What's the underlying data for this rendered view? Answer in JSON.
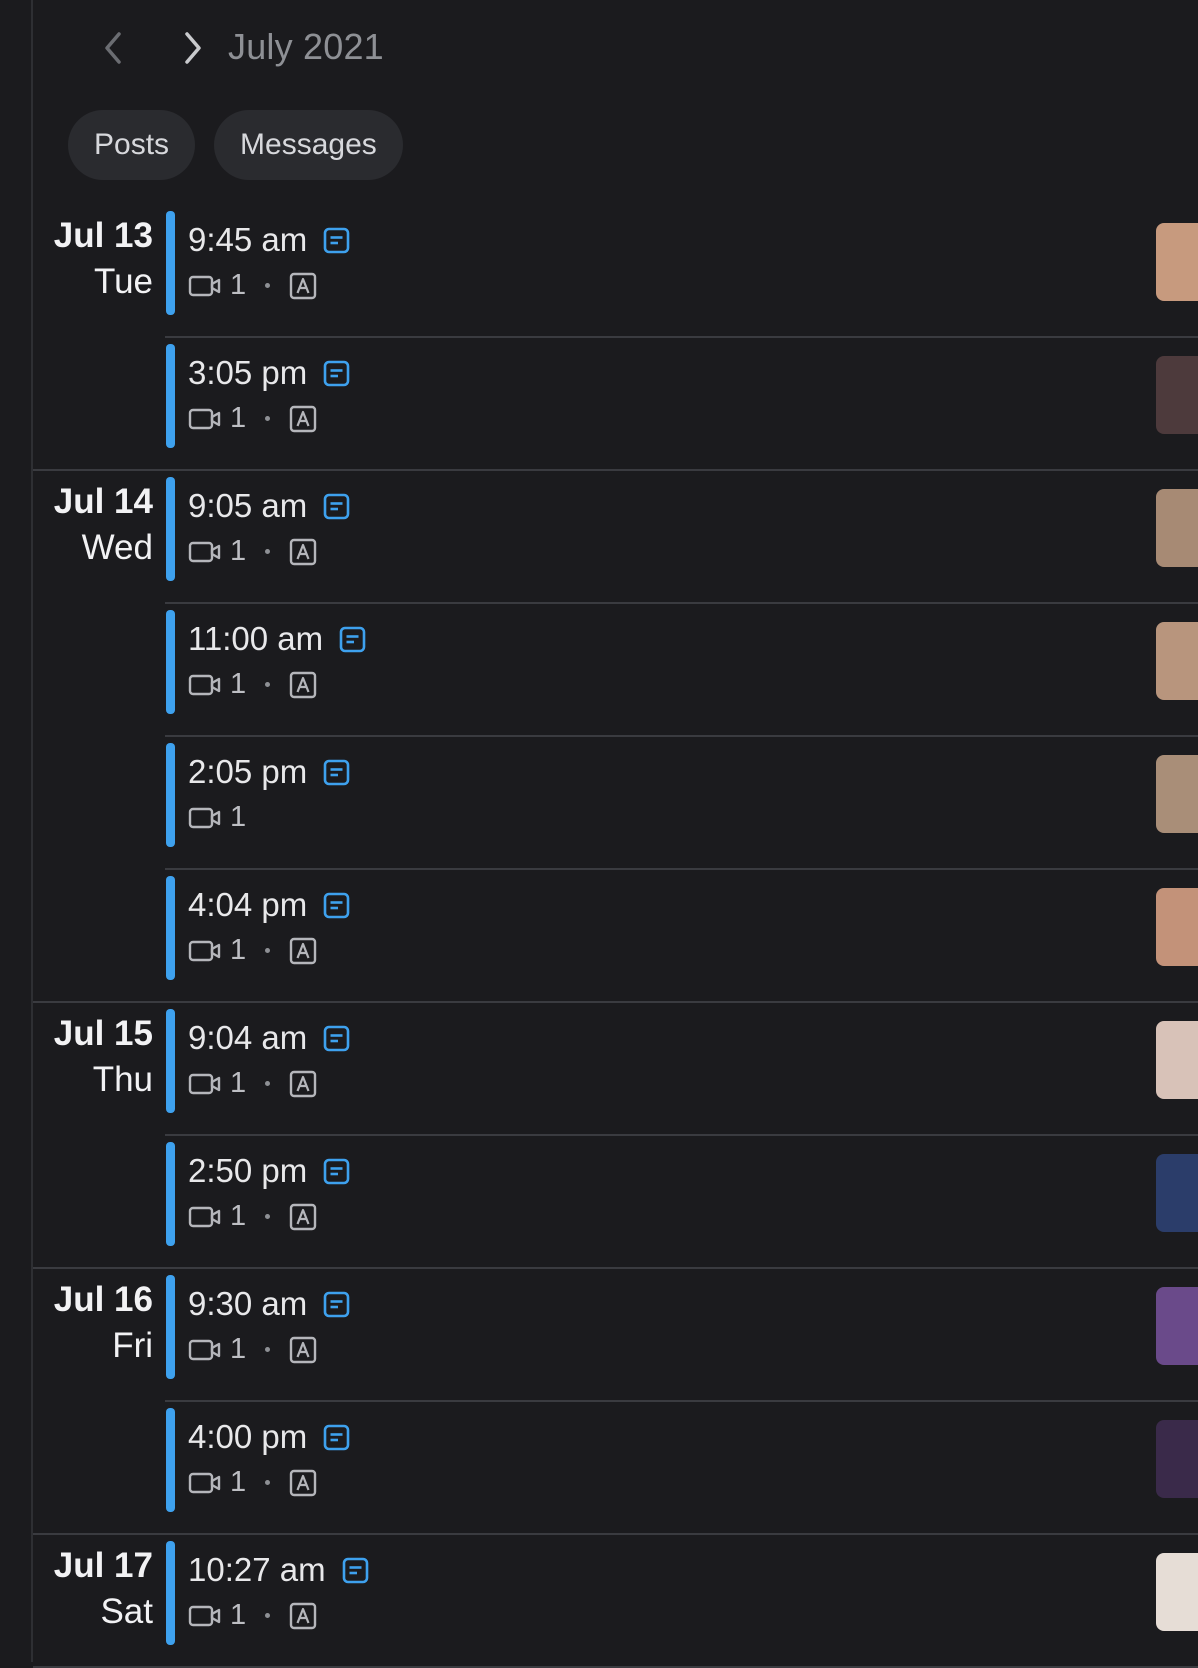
{
  "header": {
    "prev_label": "Previous month",
    "next_label": "Next month",
    "month_title": "July 2021"
  },
  "filters": [
    "Posts",
    "Messages"
  ],
  "colors": {
    "background": "#1b1b1e",
    "accent": "#3ea1ee",
    "divider": "#3a3b40",
    "chip_bg": "#2a2b2f"
  },
  "days": [
    {
      "date": "Jul 13",
      "weekday": "Tue",
      "events": [
        {
          "time": "9:45 am",
          "count": "1",
          "auto": true,
          "thumb": "#c79a7e"
        },
        {
          "time": "3:05 pm",
          "count": "1",
          "auto": true,
          "thumb": "#4d3a3c"
        }
      ]
    },
    {
      "date": "Jul 14",
      "weekday": "Wed",
      "events": [
        {
          "time": "9:05 am",
          "count": "1",
          "auto": true,
          "thumb": "#a78a74"
        },
        {
          "time": "11:00 am",
          "count": "1",
          "auto": true,
          "thumb": "#b8957d"
        },
        {
          "time": "2:05 pm",
          "count": "1",
          "auto": false,
          "thumb": "#a98e78"
        },
        {
          "time": "4:04 pm",
          "count": "1",
          "auto": true,
          "thumb": "#c39279"
        }
      ]
    },
    {
      "date": "Jul 15",
      "weekday": "Thu",
      "events": [
        {
          "time": "9:04 am",
          "count": "1",
          "auto": true,
          "thumb": "#d8c2b8"
        },
        {
          "time": "2:50 pm",
          "count": "1",
          "auto": true,
          "thumb": "#2b3d6a"
        }
      ]
    },
    {
      "date": "Jul 16",
      "weekday": "Fri",
      "events": [
        {
          "time": "9:30 am",
          "count": "1",
          "auto": true,
          "thumb": "#6a4a8a"
        },
        {
          "time": "4:00 pm",
          "count": "1",
          "auto": true,
          "thumb": "#3a2a4a"
        }
      ]
    },
    {
      "date": "Jul 17",
      "weekday": "Sat",
      "events": [
        {
          "time": "10:27 am",
          "count": "1",
          "auto": true,
          "thumb": "#e6ddd6"
        }
      ]
    }
  ]
}
